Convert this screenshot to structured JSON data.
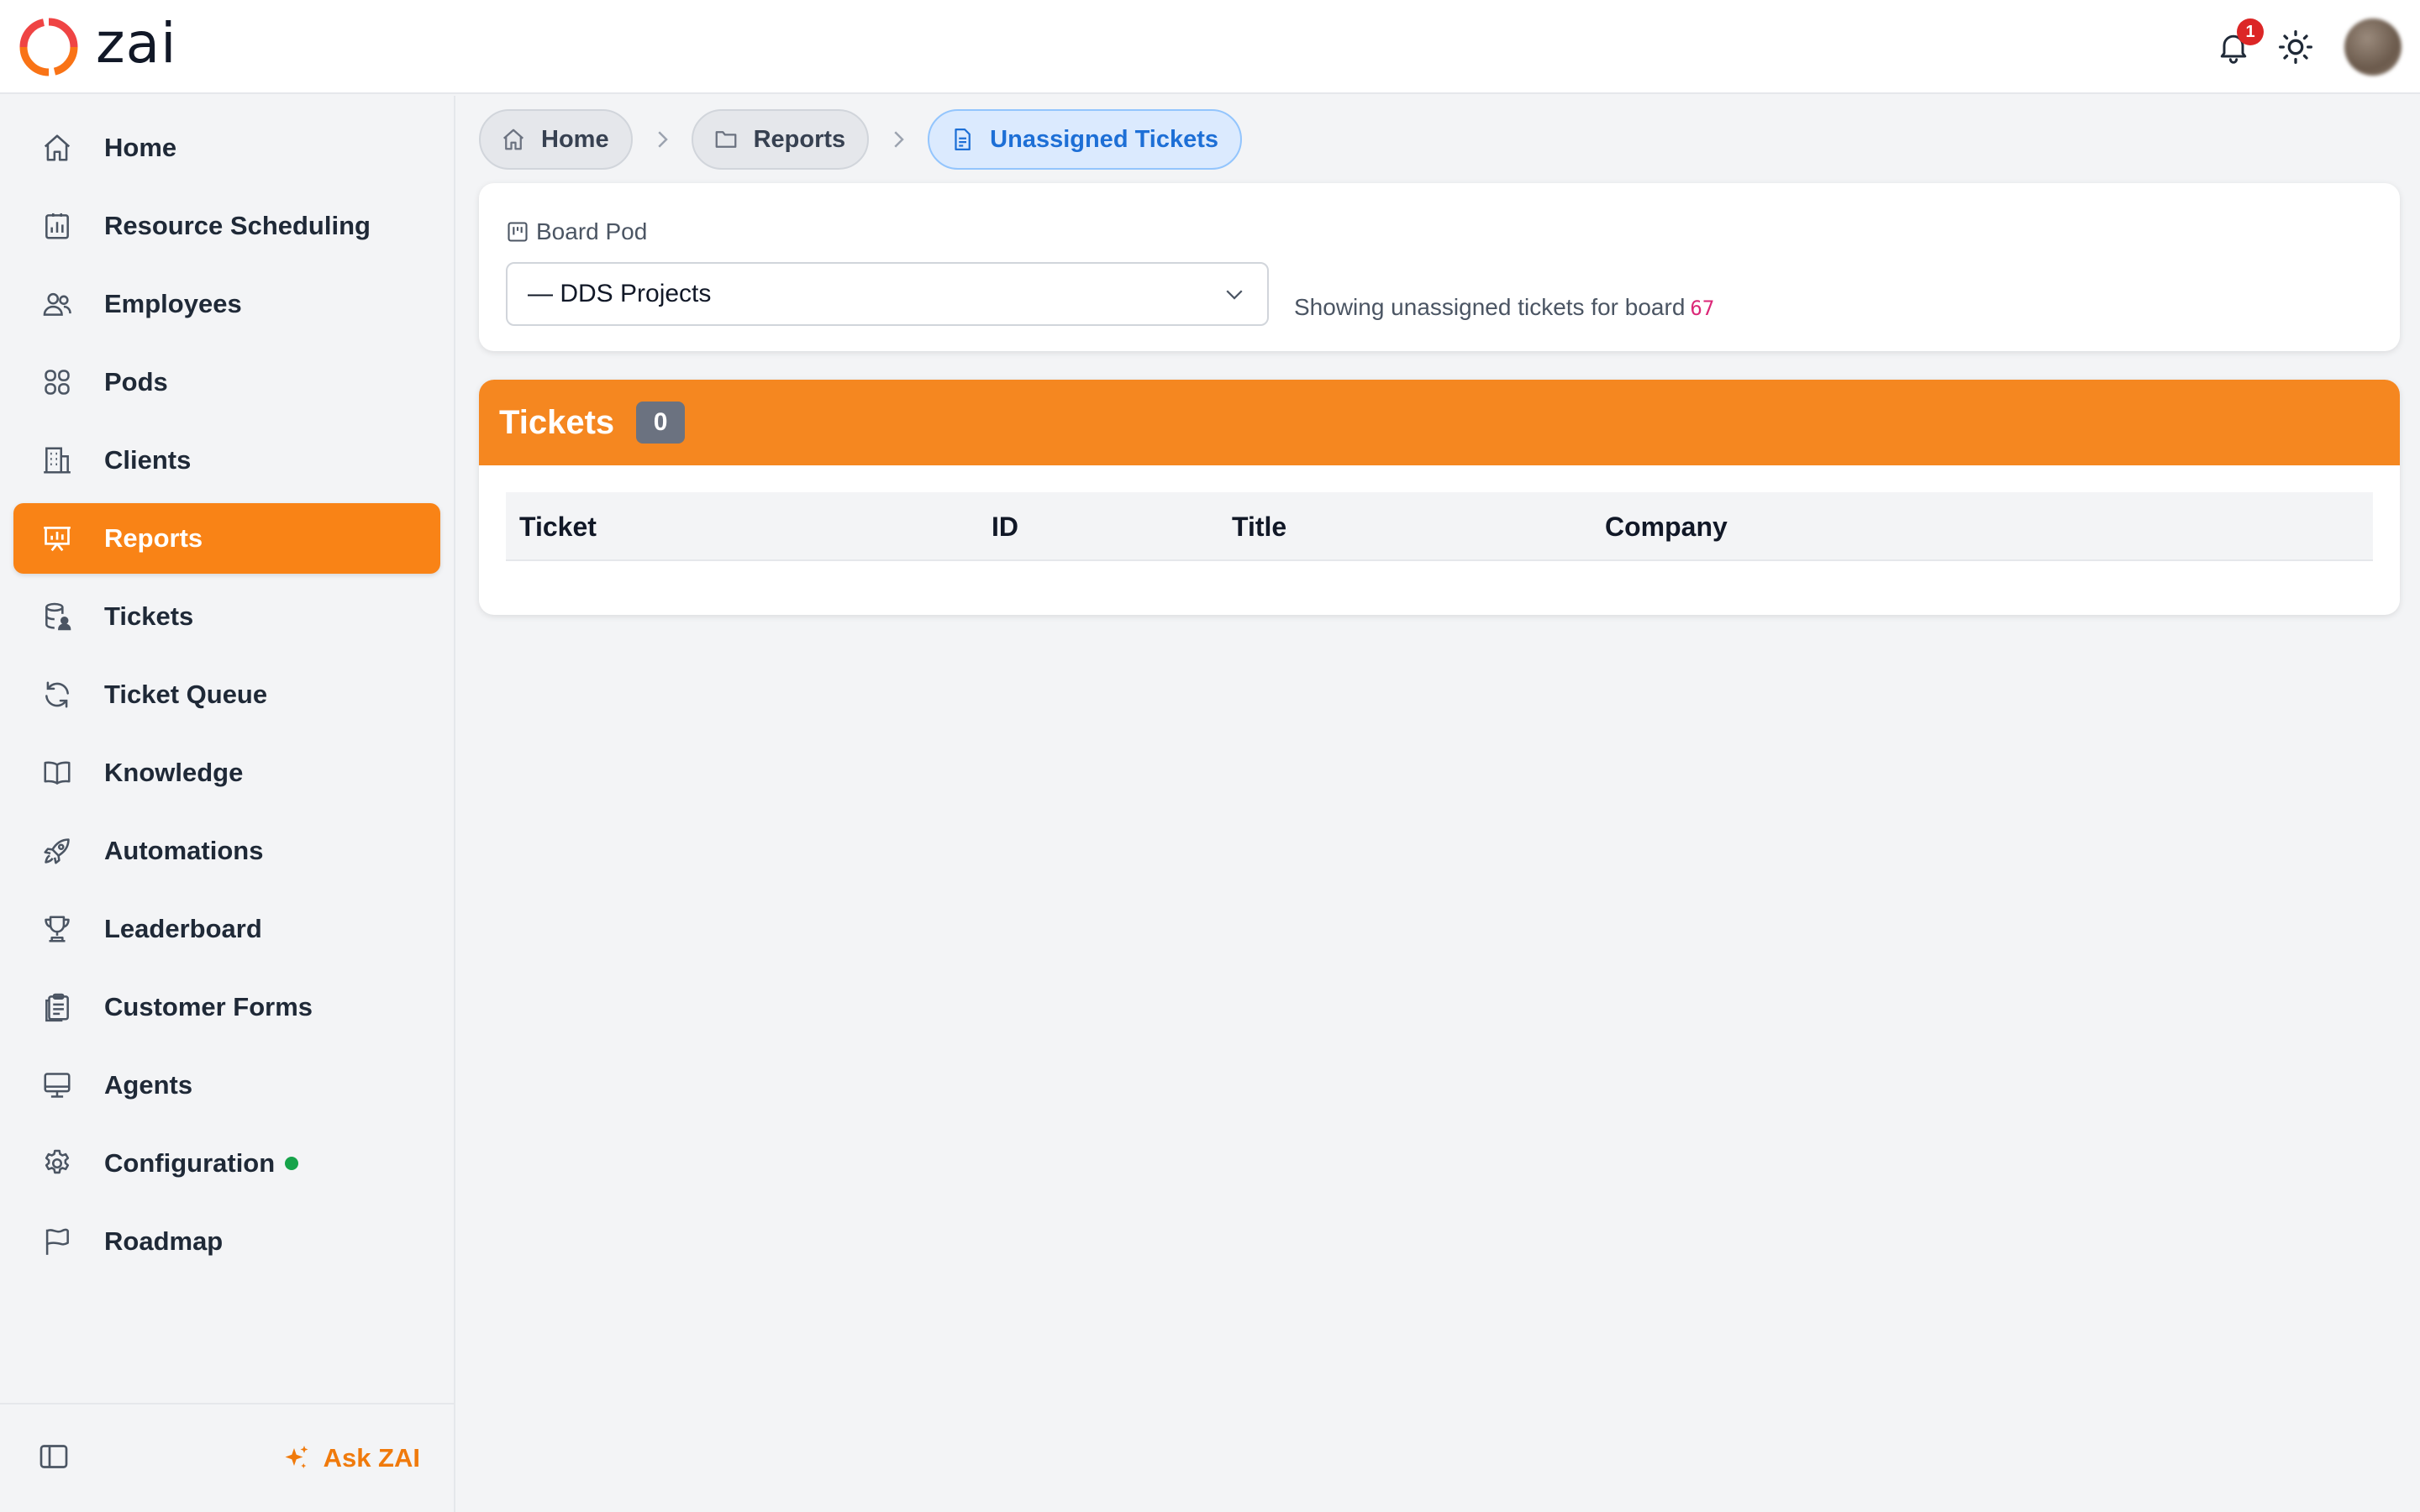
{
  "app": {
    "name": "zai"
  },
  "header": {
    "notification_count": "1"
  },
  "sidebar": {
    "items": [
      {
        "label": "Home",
        "icon": "home-icon"
      },
      {
        "label": "Resource Scheduling",
        "icon": "chart-icon"
      },
      {
        "label": "Employees",
        "icon": "users-icon"
      },
      {
        "label": "Pods",
        "icon": "grid-icon"
      },
      {
        "label": "Clients",
        "icon": "building-icon"
      },
      {
        "label": "Reports",
        "icon": "presentation-icon",
        "active": true
      },
      {
        "label": "Tickets",
        "icon": "database-user-icon"
      },
      {
        "label": "Ticket Queue",
        "icon": "refresh-icon"
      },
      {
        "label": "Knowledge",
        "icon": "book-icon"
      },
      {
        "label": "Automations",
        "icon": "rocket-icon"
      },
      {
        "label": "Leaderboard",
        "icon": "trophy-icon"
      },
      {
        "label": "Customer Forms",
        "icon": "clipboard-icon"
      },
      {
        "label": "Agents",
        "icon": "monitor-icon"
      },
      {
        "label": "Configuration",
        "icon": "gear-icon",
        "status_dot": true
      },
      {
        "label": "Roadmap",
        "icon": "flag-icon"
      }
    ],
    "ask_label": "Ask ZAI"
  },
  "breadcrumb": {
    "items": [
      "Home",
      "Reports",
      "Unassigned Tickets"
    ]
  },
  "filter": {
    "label": "Board Pod",
    "selected": "— DDS Projects",
    "showing_text": "Showing unassigned tickets for board",
    "board_id": "67"
  },
  "tickets": {
    "title": "Tickets",
    "count": "0",
    "columns": [
      "Ticket",
      "ID",
      "Title",
      "Company"
    ],
    "rows": []
  },
  "colors": {
    "accent": "#f98316",
    "tickets_header": "#f58720",
    "breadcrumb_current": "#1d6fd6",
    "board_id": "#db2777",
    "status_dot": "#16a34a",
    "notification": "#dc2626"
  }
}
